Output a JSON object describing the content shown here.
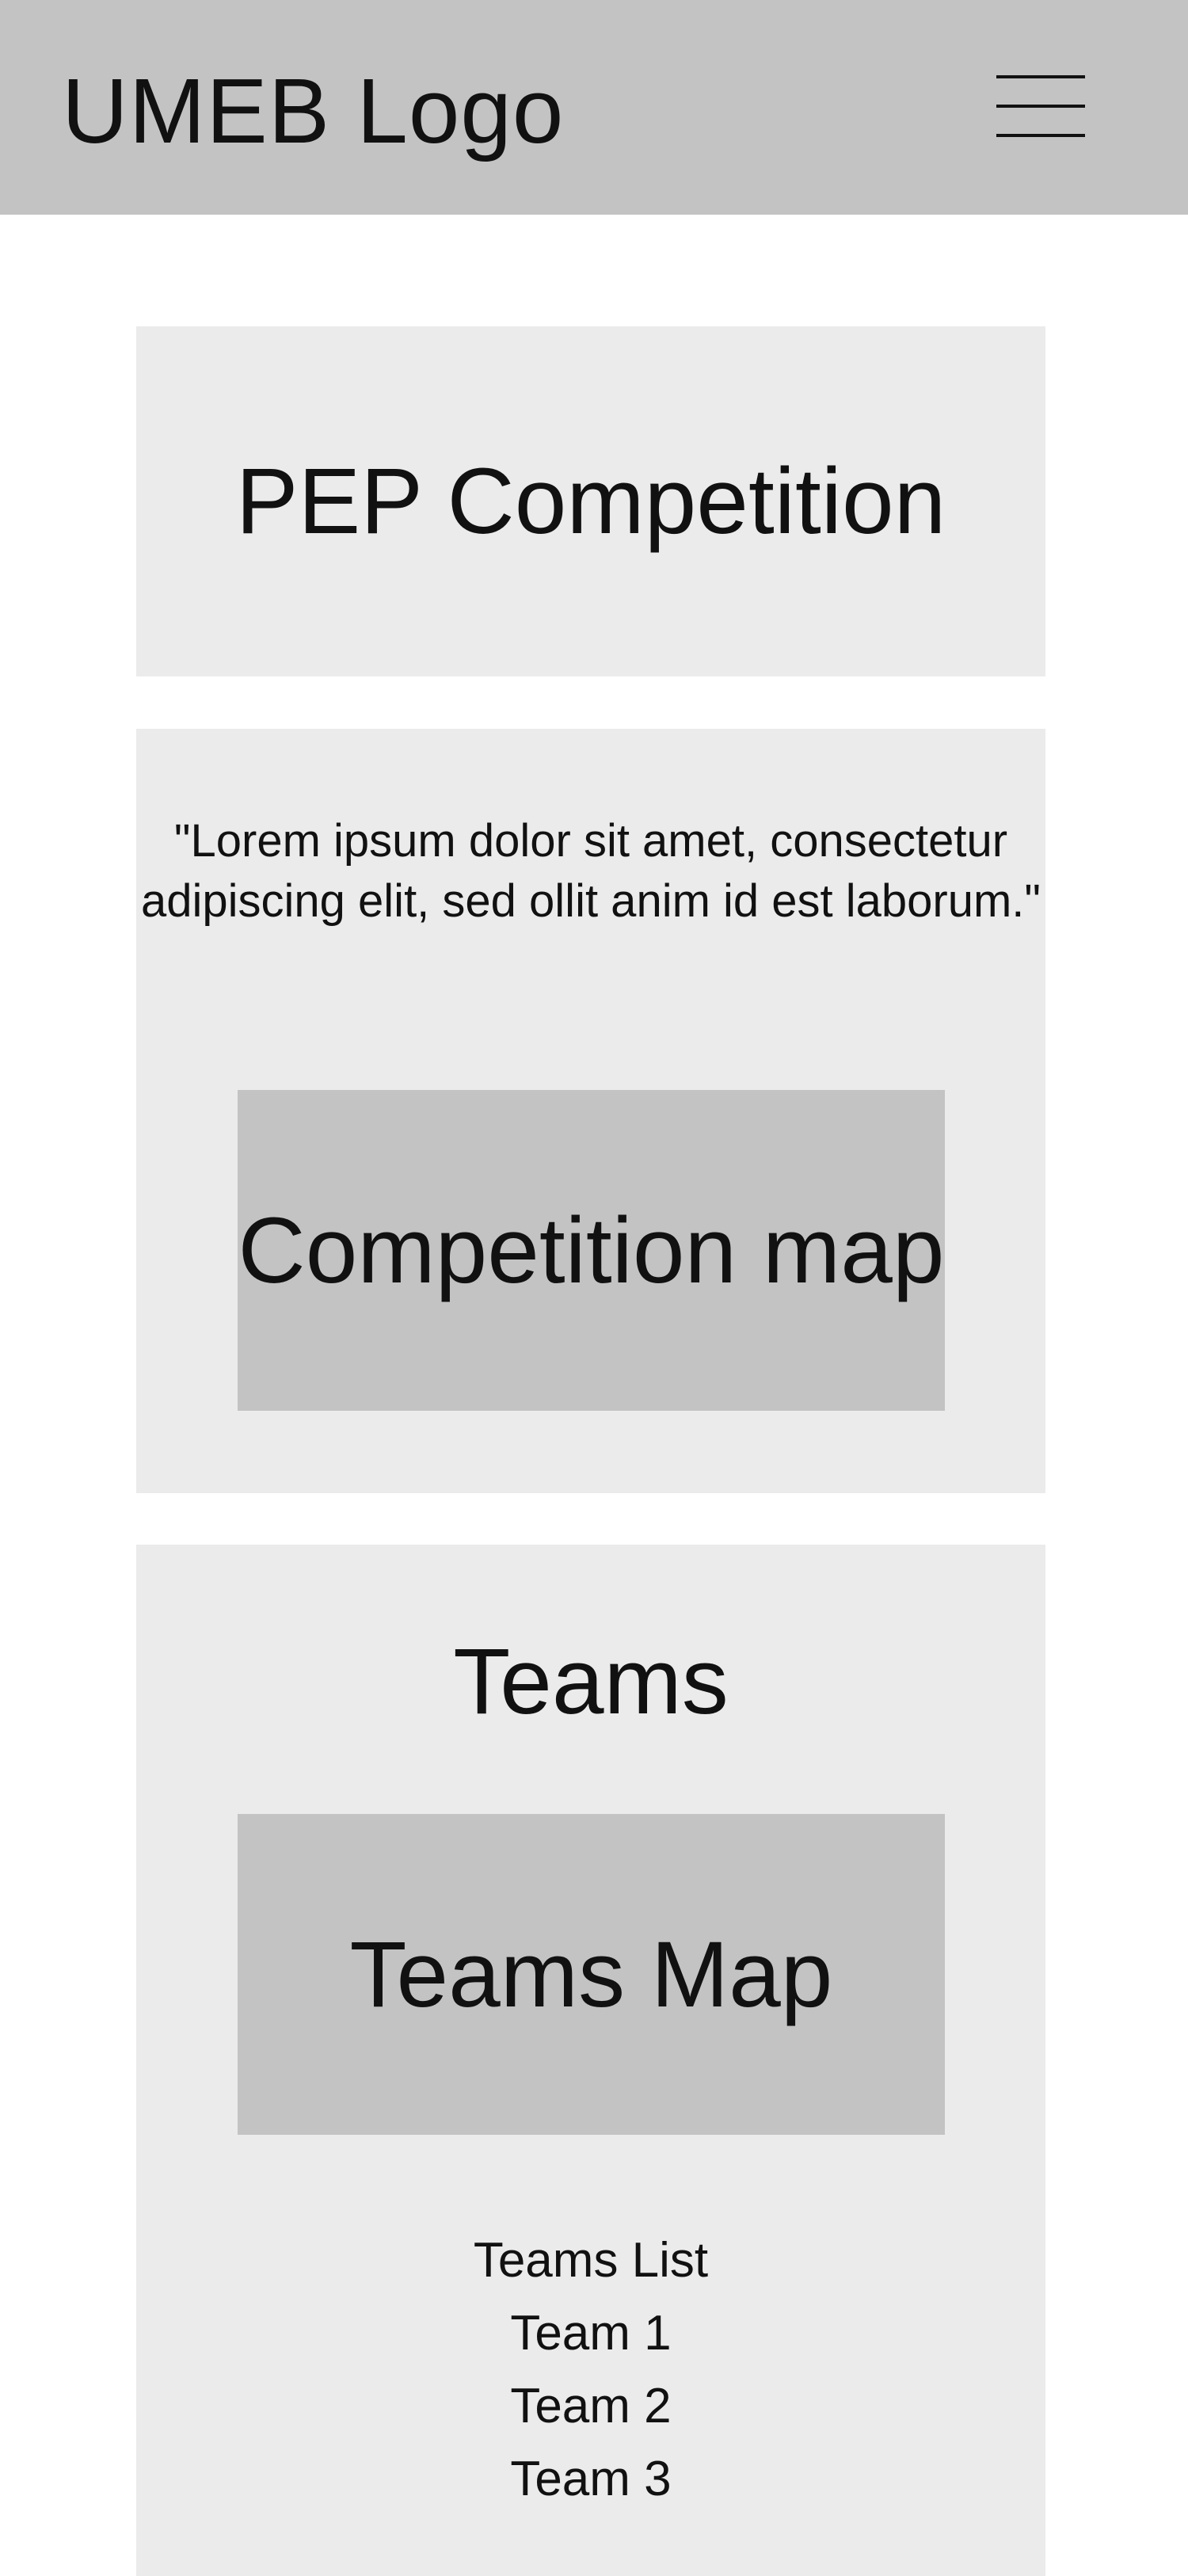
{
  "header": {
    "logo_text": "UMEB Logo",
    "menu_icon": "hamburger-menu-icon"
  },
  "hero": {
    "title": "PEP Competition"
  },
  "competition": {
    "quote": "\"Lorem ipsum dolor sit amet, consectetur adipiscing elit, sed ollit anim id est laborum.\"",
    "map_label": "Competition map"
  },
  "teams": {
    "heading": "Teams",
    "map_label": "Teams Map",
    "list_title": "Teams List",
    "items": [
      "Team 1",
      "Team 2",
      "Team 3"
    ]
  },
  "colors": {
    "header_bg": "#c3c3c3",
    "card_bg": "#ebebeb",
    "placeholder_bg": "#c3c3c3",
    "text": "#111111"
  }
}
